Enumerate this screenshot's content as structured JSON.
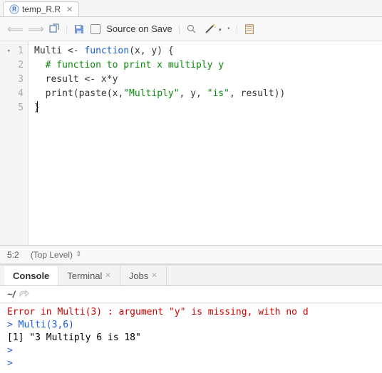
{
  "tab": {
    "filename": "temp_R.R"
  },
  "toolbar": {
    "source_on_save": "Source on Save"
  },
  "gutter": {
    "lines": [
      "1",
      "2",
      "3",
      "4",
      "5"
    ]
  },
  "code": {
    "l1a": "Multi <- ",
    "l1b": "function",
    "l1c": "(x, y) {",
    "l2": "  # function to print x multiply y",
    "l3": "  result <- x*y",
    "l4a": "  print(paste(x,",
    "l4b": "\"Multiply\"",
    "l4c": ", y, ",
    "l4d": "\"is\"",
    "l4e": ", result))",
    "l5": "}"
  },
  "status": {
    "pos": "5:2",
    "scope": "(Top Level)"
  },
  "bottom_tabs": {
    "console": "Console",
    "terminal": "Terminal",
    "jobs": "Jobs"
  },
  "console": {
    "cwd": "~/",
    "err": "Error in Multi(3) : argument \"y\" is missing, with no d",
    "cmd": "Multi(3,6)",
    "out": "[1] \"3 Multiply 6 is 18\"",
    "prompt": ">"
  }
}
